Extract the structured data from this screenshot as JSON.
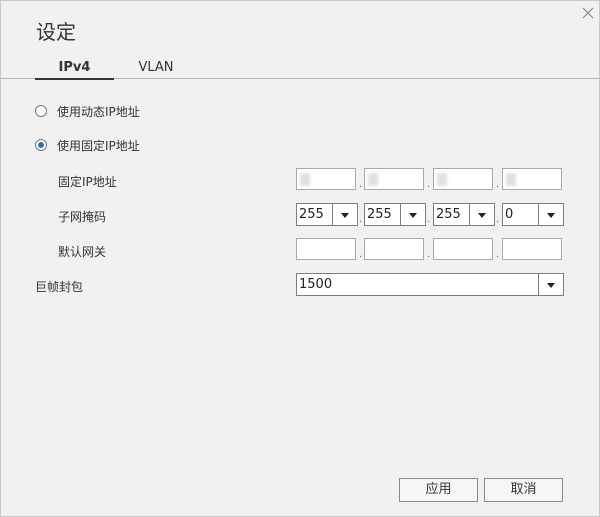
{
  "dialog": {
    "title": "设定",
    "close_icon": "close-icon"
  },
  "tabs": [
    {
      "label": "IPv4",
      "active": true
    },
    {
      "label": "VLAN",
      "active": false
    }
  ],
  "ip_mode": {
    "dynamic_label": "使用动态IP地址",
    "static_label": "使用固定IP地址",
    "selected": "static"
  },
  "fields": {
    "static_ip_label": "固定IP地址",
    "subnet_mask_label": "子网掩码",
    "gateway_label": "默认网关",
    "jumbo_frame_label": "巨帧封包"
  },
  "subnet_mask": [
    "255",
    "255",
    "255",
    "0"
  ],
  "jumbo_frame": {
    "value": "1500"
  },
  "buttons": {
    "apply": "应用",
    "cancel": "取消"
  }
}
